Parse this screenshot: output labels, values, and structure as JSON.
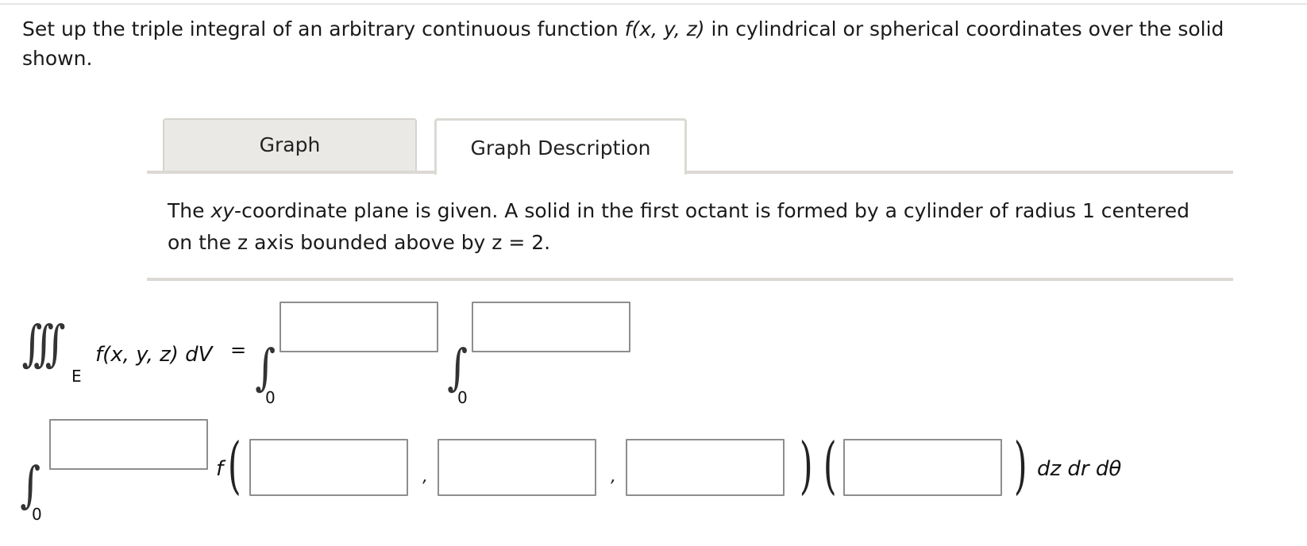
{
  "question": {
    "text_before": "Set up the triple integral of an arbitrary continuous function ",
    "func": "f(x, y, z)",
    "text_after": " in cylindrical or spherical coordinates over the solid shown."
  },
  "tabs": [
    {
      "label": "Graph"
    },
    {
      "label": "Graph Description"
    }
  ],
  "description": {
    "before": "The ",
    "italic": "xy",
    "after": "-coordinate plane is given. A solid in the first octant is formed by a cylinder of radius 1 centered on the z axis bounded above by z = 2."
  },
  "integral": {
    "triple_sign": "∫∫∫",
    "region": "E",
    "integrand": "f(x, y, z) dV",
    "equals": "=",
    "sign": "∫",
    "lower_bound": "0",
    "f_label": "f",
    "comma": ",",
    "differentials": "dz dr dθ"
  },
  "answers": {
    "upper1": "",
    "upper2": "",
    "upper3": "",
    "f_arg1": "",
    "f_arg2": "",
    "f_arg3": "",
    "jacobian": ""
  }
}
